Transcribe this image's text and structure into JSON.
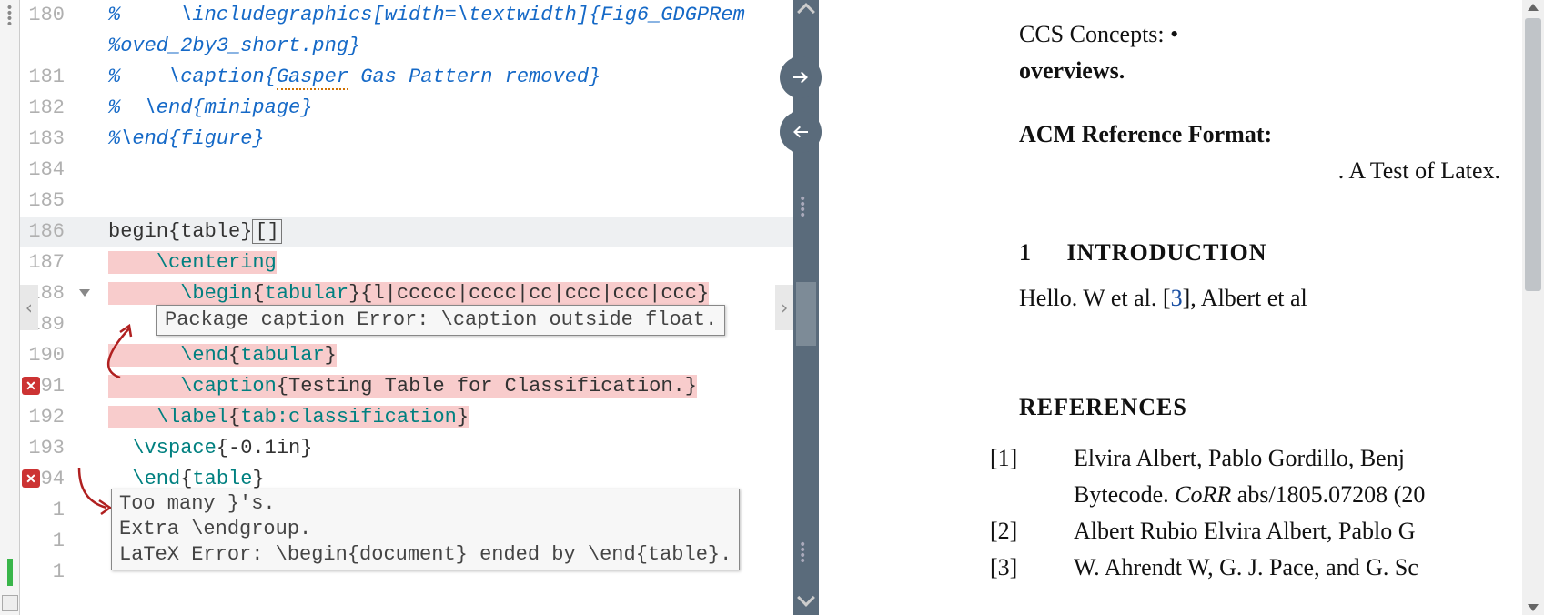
{
  "icons": {
    "error_x": "✕",
    "dots": "⋮"
  },
  "editor": {
    "lines": [
      {
        "num": "180",
        "segments": [
          {
            "cls": "tk-comment",
            "txt": "%     \\includegraphics[width=\\textwidth]{Fig6_GDGPRem"
          }
        ]
      },
      {
        "num": "",
        "segments": [
          {
            "cls": "tk-comment",
            "txt": "%oved_2by3_short.png}"
          }
        ]
      },
      {
        "num": "181",
        "segments": [
          {
            "cls": "tk-comment",
            "txt": "%    \\caption{"
          },
          {
            "cls": "tk-comment spellwave",
            "txt": "Gasper"
          },
          {
            "cls": "tk-comment",
            "txt": " Gas Pattern removed}"
          }
        ]
      },
      {
        "num": "182",
        "segments": [
          {
            "cls": "tk-comment",
            "txt": "%  \\end{minipage}"
          }
        ]
      },
      {
        "num": "183",
        "segments": [
          {
            "cls": "tk-comment",
            "txt": "%\\end{figure}"
          }
        ]
      },
      {
        "num": "184",
        "segments": []
      },
      {
        "num": "185",
        "segments": []
      },
      {
        "num": "186",
        "current": true,
        "segments": [
          {
            "cls": "tk-plain",
            "txt": "begin{table}"
          },
          {
            "cls": "tk-plain cursor-box",
            "txt": "[]"
          }
        ]
      },
      {
        "num": "187",
        "pink": true,
        "segments": [
          {
            "cls": "tk-plain",
            "txt": "    "
          },
          {
            "cls": "tk-cmd2",
            "txt": "\\centering"
          }
        ]
      },
      {
        "num": "188",
        "pink": true,
        "fold": true,
        "segments": [
          {
            "cls": "tk-plain",
            "txt": "      "
          },
          {
            "cls": "tk-cmd2",
            "txt": "\\begin"
          },
          {
            "cls": "tk-plain",
            "txt": "{"
          },
          {
            "cls": "tk-arg",
            "txt": "tabular"
          },
          {
            "cls": "tk-plain",
            "txt": "}{l|"
          },
          {
            "cls": "tk-plain spellwave",
            "txt": "ccccc"
          },
          {
            "cls": "tk-plain",
            "txt": "|"
          },
          {
            "cls": "tk-plain spellwave",
            "txt": "cccc"
          },
          {
            "cls": "tk-plain",
            "txt": "|cc|"
          },
          {
            "cls": "tk-plain spellwave",
            "txt": "ccc"
          },
          {
            "cls": "tk-plain",
            "txt": "|"
          },
          {
            "cls": "tk-plain spellwave",
            "txt": "ccc"
          },
          {
            "cls": "tk-plain",
            "txt": "|"
          },
          {
            "cls": "tk-plain spellwave",
            "txt": "ccc"
          },
          {
            "cls": "tk-plain",
            "txt": "}"
          }
        ]
      },
      {
        "num": "189",
        "segments": []
      },
      {
        "num": "190",
        "pink": true,
        "segments": [
          {
            "cls": "tk-plain",
            "txt": "      "
          },
          {
            "cls": "tk-cmd2",
            "txt": "\\end"
          },
          {
            "cls": "tk-plain",
            "txt": "{"
          },
          {
            "cls": "tk-arg",
            "txt": "tabular"
          },
          {
            "cls": "tk-plain",
            "txt": "}"
          }
        ]
      },
      {
        "num": "191",
        "error": true,
        "pink": true,
        "segments": [
          {
            "cls": "tk-plain",
            "txt": "      "
          },
          {
            "cls": "tk-cmd2",
            "txt": "\\caption"
          },
          {
            "cls": "tk-plain",
            "txt": "{Testing Table for Classification.}"
          }
        ]
      },
      {
        "num": "192",
        "pink": true,
        "segments": [
          {
            "cls": "tk-plain",
            "txt": "    "
          },
          {
            "cls": "tk-cmd2",
            "txt": "\\label"
          },
          {
            "cls": "tk-plain",
            "txt": "{"
          },
          {
            "cls": "tk-arg",
            "txt": "tab:classification"
          },
          {
            "cls": "tk-plain",
            "txt": "}"
          }
        ]
      },
      {
        "num": "193",
        "segments": [
          {
            "cls": "tk-plain",
            "txt": "  "
          },
          {
            "cls": "tk-cmd2",
            "txt": "\\vspace"
          },
          {
            "cls": "tk-plain",
            "txt": "{-0.1in}"
          }
        ]
      },
      {
        "num": "194",
        "error": true,
        "segments": [
          {
            "cls": "tk-plain",
            "txt": "  "
          },
          {
            "cls": "tk-cmd2",
            "txt": "\\end"
          },
          {
            "cls": "tk-plain",
            "txt": "{"
          },
          {
            "cls": "tk-arg",
            "txt": "table"
          },
          {
            "cls": "tk-plain",
            "txt": "}"
          }
        ]
      },
      {
        "num": "1",
        "segments": []
      },
      {
        "num": "1",
        "segments": []
      },
      {
        "num": "1",
        "segments": []
      }
    ],
    "tooltip1": "Package caption Error: \\caption outside float.",
    "tooltip2": "Too many }'s.\nExtra \\endgroup.\nLaTeX Error: \\begin{document} ended by \\end{table}."
  },
  "pdf": {
    "line_ccs_a": "CCS Concepts: •",
    "line_ccs_b": "overviews.",
    "acm_ref": "ACM Reference Format:",
    "acm_body": ". A Test of Latex.",
    "sec1_num": "1",
    "sec1_title": "INTRODUCTION",
    "intro_a": "Hello. W et al. [",
    "intro_link": "3",
    "intro_b": "], Albert et al",
    "refs_title": "REFERENCES",
    "refs": [
      {
        "n": "[1]",
        "a": "Elvira Albert, Pablo Gordillo, Benj",
        "b": "Bytecode. ",
        "i": "CoRR",
        "c": " abs/1805.07208 (20"
      },
      {
        "n": "[2]",
        "a": "Albert Rubio Elvira Albert, Pablo G"
      },
      {
        "n": "[3]",
        "a": "W. Ahrendt W, G. J. Pace, and G. Sc"
      }
    ]
  }
}
